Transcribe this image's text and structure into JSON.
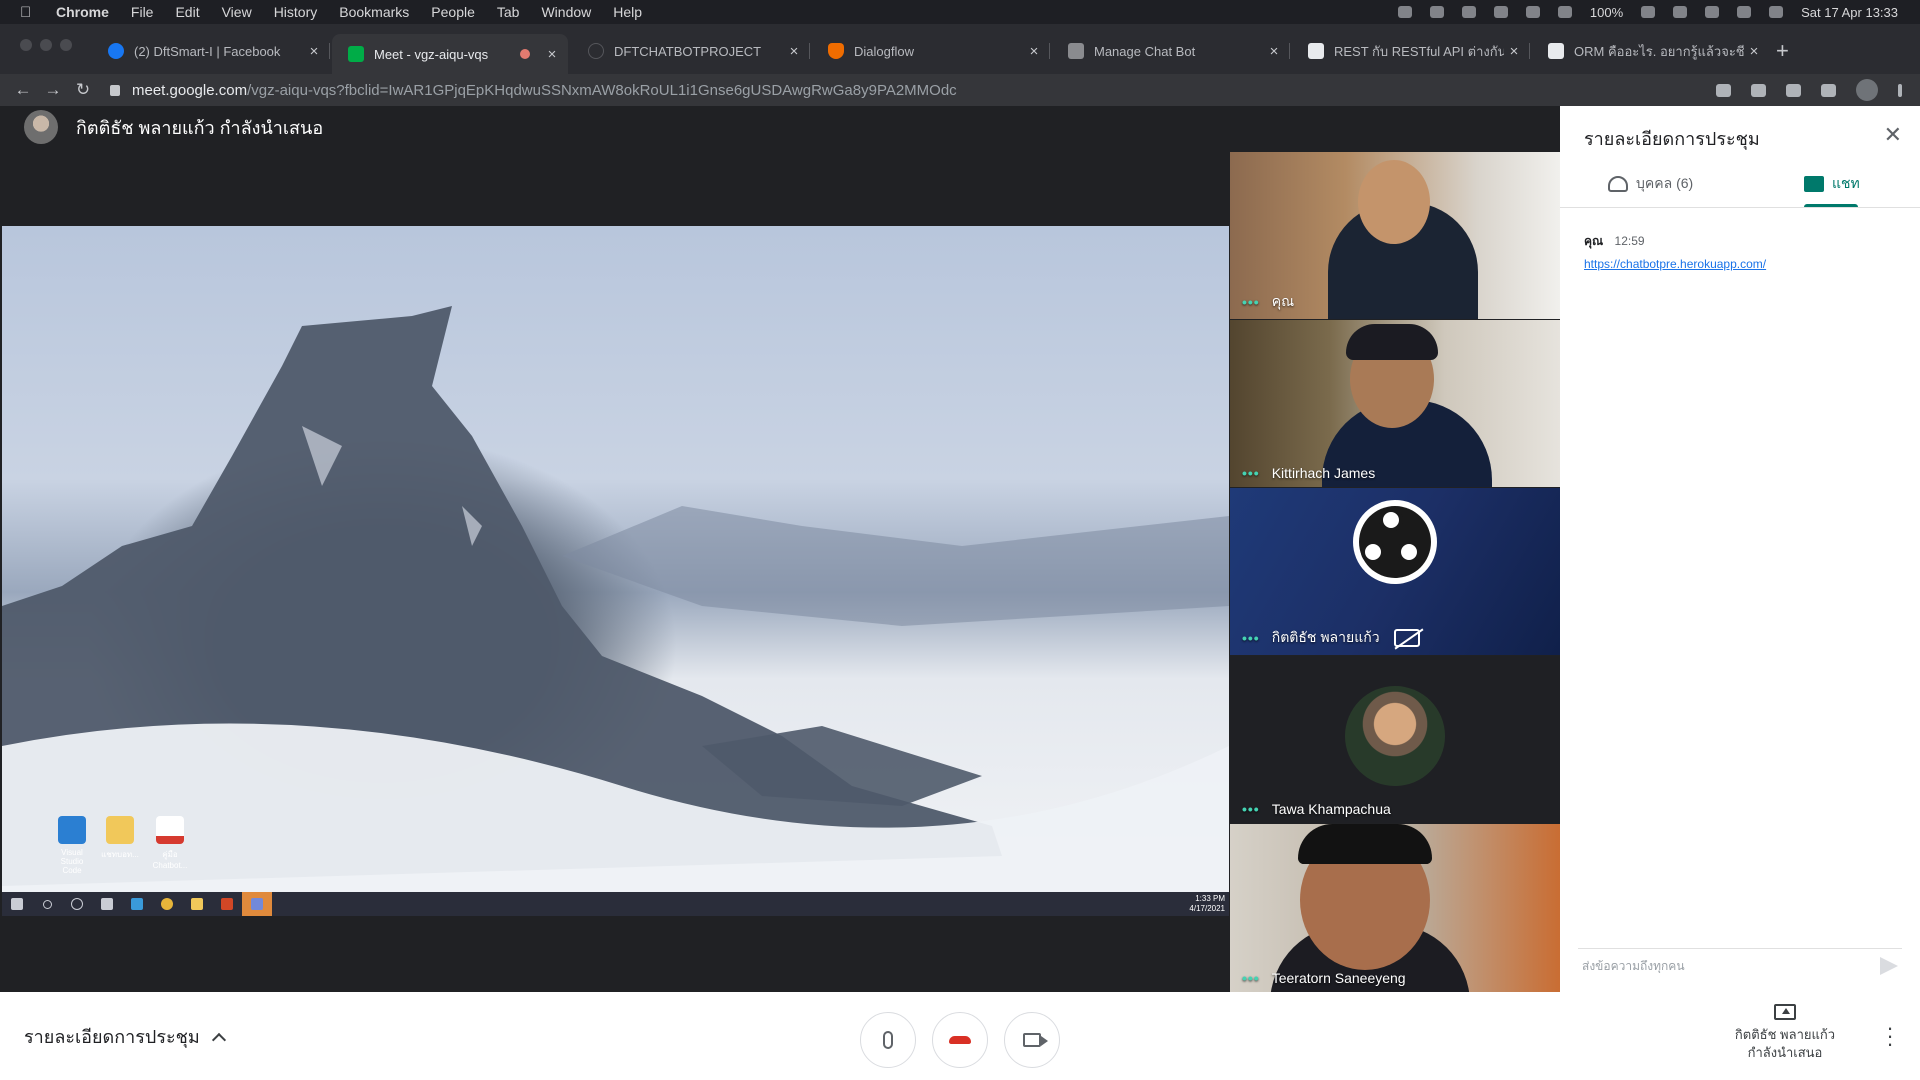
{
  "menubar": {
    "app": "Chrome",
    "items": [
      "File",
      "Edit",
      "View",
      "History",
      "Bookmarks",
      "People",
      "Tab",
      "Window",
      "Help"
    ],
    "battery": "100%",
    "datetime": "Sat 17 Apr 13:33"
  },
  "tabs": [
    {
      "title": "(2) DftSmart-I | Facebook",
      "favicon_color": "#1877f2"
    },
    {
      "title": "Meet - vgz-aiqu-vqs",
      "favicon_color": "#00ac47",
      "active": true
    },
    {
      "title": "DFTCHATBOTPROJECT",
      "favicon_color": "#2b2c31"
    },
    {
      "title": "Dialogflow",
      "favicon_color": "#ef6c00"
    },
    {
      "title": "Manage Chat Bot",
      "favicon_color": "#8a8b8f"
    },
    {
      "title": "REST กับ RESTful API ต่างกันอย่างไร",
      "favicon_color": "#e8eaed"
    },
    {
      "title": "ORM คืออะไร. อยากรู้แล้วจะชีวิต",
      "favicon_color": "#e8eaed"
    }
  ],
  "address": {
    "host": "meet.google.com",
    "path": "/vgz-aiqu-vqs?fbclid=IwAR1GPjqEpKHqdwuSSNxmAW8okRoUL1i1Gnse6gUSDAwgRwGa8y9PA2MMOdc"
  },
  "presenter": {
    "label": "กิตติธัช พลายแก้ว กำลังนำเสนอ"
  },
  "shared_screen": {
    "desktop_icons": [
      {
        "label": "Visual Studio Code",
        "color": "#2b7fd2"
      },
      {
        "label": "แชทบอท...",
        "color": "#f1c85a"
      },
      {
        "label": "คู่มือ Chatbot...",
        "color": "#d63a2f"
      }
    ],
    "clock_time": "1:33 PM",
    "clock_date": "4/17/2021"
  },
  "participants": [
    {
      "name": "คุณ"
    },
    {
      "name": "Kittirhach James"
    },
    {
      "name": "กิตติธัช พลายแก้ว"
    },
    {
      "name": "Tawa Khampachua"
    },
    {
      "name": "Teeratorn Saneeyeng"
    }
  ],
  "panel": {
    "title": "รายละเอียดการประชุม",
    "tab_people": "บุคคล (6)",
    "tab_chat": "แชท",
    "message": {
      "sender": "คุณ",
      "time": "12:59",
      "link": "https://chatbotpre.herokuapp.com/"
    },
    "input_placeholder": "ส่งข้อความถึงทุกคน"
  },
  "bottombar": {
    "details_label": "รายละเอียดการประชุม",
    "present_line1": "กิตติธัช พลายแก้ว",
    "present_line2": "กำลังนำเสนอ"
  },
  "colors": {
    "accent": "#00796b",
    "hangup": "#d93025",
    "link": "#1a73e8",
    "active_speaker_dots": "#45d3b3"
  }
}
